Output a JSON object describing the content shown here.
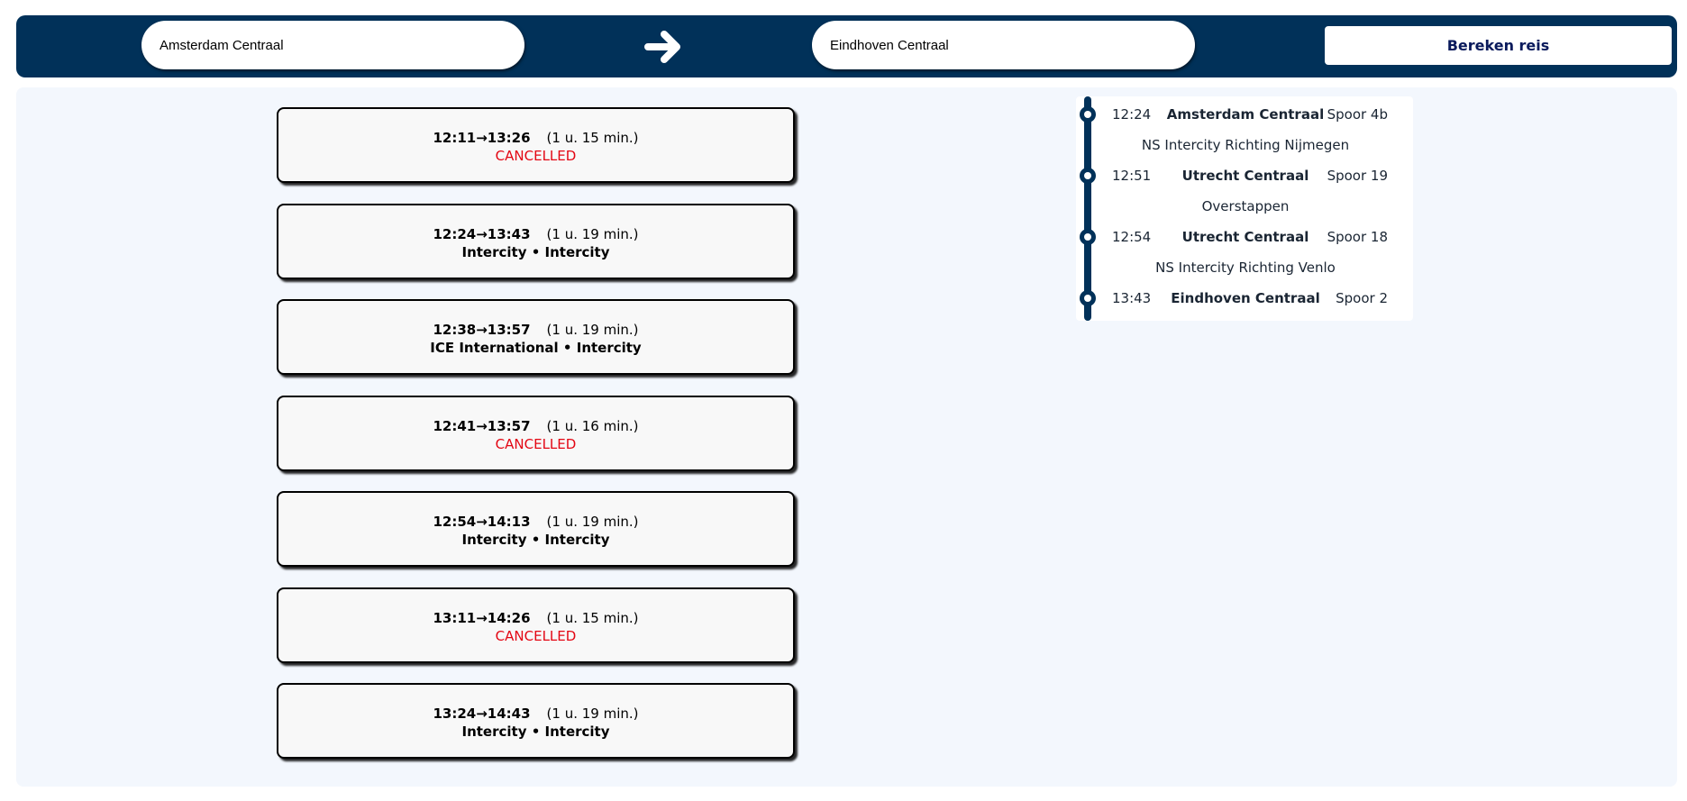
{
  "search": {
    "from_value": "Amsterdam Centraal",
    "to_value": "Eindhoven Centraal",
    "button_label": "Bereken reis",
    "arrow_icon": "arrow-right-icon"
  },
  "colors": {
    "header_bg": "#013159",
    "panel_bg": "#f3f7fd",
    "cancelled": "#e30613",
    "button_text": "#0a1a5c"
  },
  "trips": [
    {
      "times": "12:11→13:26",
      "duration": "(1 u. 15 min.)",
      "detail": "CANCELLED",
      "cancelled": true
    },
    {
      "times": "12:24→13:43",
      "duration": "(1 u. 19 min.)",
      "detail": "Intercity • Intercity",
      "cancelled": false
    },
    {
      "times": "12:38→13:57",
      "duration": "(1 u. 19 min.)",
      "detail": "ICE International • Intercity",
      "cancelled": false
    },
    {
      "times": "12:41→13:57",
      "duration": "(1 u. 16 min.)",
      "detail": "CANCELLED",
      "cancelled": true
    },
    {
      "times": "12:54→14:13",
      "duration": "(1 u. 19 min.)",
      "detail": "Intercity • Intercity",
      "cancelled": false
    },
    {
      "times": "13:11→14:26",
      "duration": "(1 u. 15 min.)",
      "detail": "CANCELLED",
      "cancelled": true
    },
    {
      "times": "13:24→14:43",
      "duration": "(1 u. 19 min.)",
      "detail": "Intercity • Intercity",
      "cancelled": false
    }
  ],
  "journey": {
    "stops": [
      {
        "time": "12:24",
        "station": "Amsterdam Centraal",
        "track": "Spoor 4b"
      },
      {
        "time": "12:51",
        "station": "Utrecht Centraal",
        "track": "Spoor 19"
      },
      {
        "time": "12:54",
        "station": "Utrecht Centraal",
        "track": "Spoor 18"
      },
      {
        "time": "13:43",
        "station": "Eindhoven Centraal",
        "track": "Spoor 2"
      }
    ],
    "legs": [
      "NS Intercity Richting Nijmegen",
      "Overstappen",
      "NS Intercity Richting Venlo"
    ]
  }
}
